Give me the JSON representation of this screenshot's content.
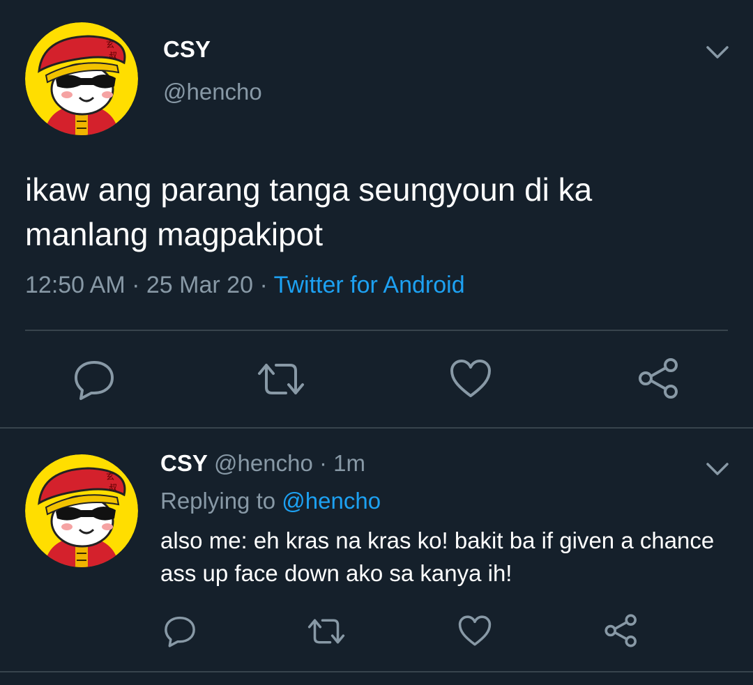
{
  "main_tweet": {
    "display_name": "CSY",
    "handle": "@hencho",
    "text": "ikaw ang parang tanga seungyoun di ka manlang magpakipot",
    "time": "12:50 AM",
    "separator": "·",
    "date": "25 Mar 20",
    "source": "Twitter for Android",
    "actions": [
      {
        "name": "reply",
        "icon": "reply-icon"
      },
      {
        "name": "retweet",
        "icon": "retweet-icon"
      },
      {
        "name": "like",
        "icon": "heart-icon"
      },
      {
        "name": "share",
        "icon": "share-icon"
      }
    ]
  },
  "reply_tweet": {
    "display_name": "CSY",
    "handle": "@hencho",
    "separator": "·",
    "time_ago": "1m",
    "replying_prefix": "Replying to",
    "replying_to": "@hencho",
    "text": "also me: eh kras na kras ko! bakit ba if given a chance ass up face down ako sa kanya ih!"
  },
  "colors": {
    "background": "#15202b",
    "primary_text": "#ffffff",
    "secondary_text": "#8899a6",
    "link": "#1da1f2",
    "divider": "#38444d",
    "avatar_background": "#ffde00",
    "avatar_hat": "#d4212c"
  }
}
